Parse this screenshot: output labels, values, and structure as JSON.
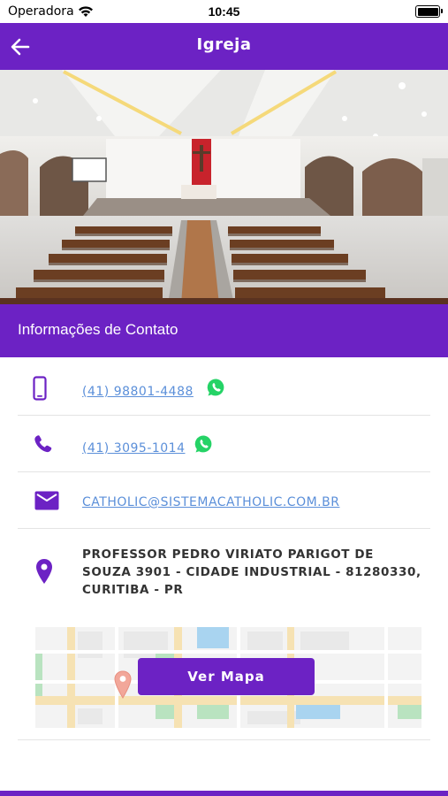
{
  "status_bar": {
    "carrier": "Operadora",
    "time": "10:45"
  },
  "header": {
    "title": "Igreja"
  },
  "section": {
    "title": "Informações de Contato"
  },
  "contacts": {
    "mobile": "(41) 98801-4488",
    "phone": "(41) 3095-1014",
    "email": "CATHOLIC@SISTEMACATHOLIC.COM.BR",
    "address": "PROFESSOR PEDRO VIRIATO PARIGOT DE SOUZA 3901 - CIDADE INDUSTRIAL - 81280330, CURITIBA - PR"
  },
  "map": {
    "button_label": "Ver Mapa"
  },
  "colors": {
    "brand": "#6c22c4",
    "link": "#5b8fd9",
    "whatsapp": "#25d366"
  },
  "icons": [
    "back-arrow-icon",
    "mobile-phone-icon",
    "phone-icon",
    "whatsapp-icon",
    "mail-icon",
    "location-pin-icon",
    "map-marker-icon"
  ]
}
